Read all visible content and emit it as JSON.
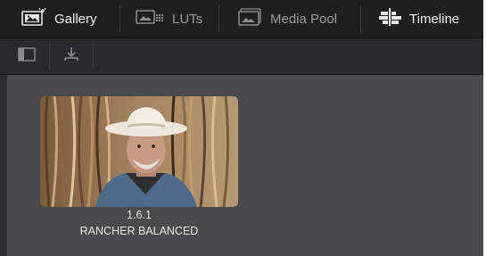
{
  "tabs": [
    {
      "label": "Gallery",
      "icon": "gallery-icon",
      "active": true
    },
    {
      "label": "LUTs",
      "icon": "luts-icon",
      "active": false
    },
    {
      "label": "Media Pool",
      "icon": "media-pool-icon",
      "active": false
    },
    {
      "label": "Timeline",
      "icon": "timeline-icon",
      "active": true
    }
  ],
  "toolbar": {
    "buttons": [
      {
        "icon": "sidebar-toggle-icon"
      },
      {
        "icon": "grab-still-icon"
      }
    ]
  },
  "gallery": {
    "stills": [
      {
        "number": "1.6.1",
        "name": "RANCHER BALANCED"
      }
    ]
  },
  "colors": {
    "tab_bar": "#1f1f22",
    "toolbar": "#2a2a2e",
    "content": "#4a4a4e",
    "active_text": "#f0f0f0",
    "inactive_text": "#9a9a9f"
  }
}
